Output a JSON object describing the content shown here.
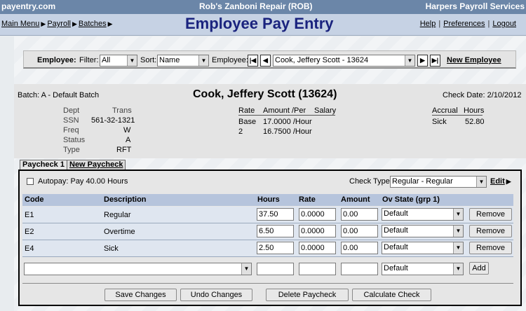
{
  "top": {
    "left": "payentry.com",
    "center": "Rob's Zanboni Repair (ROB)",
    "right": "Harpers Payroll Services"
  },
  "nav": {
    "crumbs": [
      "Main Menu",
      "Payroll",
      "Batches"
    ],
    "title": "Employee Pay Entry",
    "links": [
      "Help",
      "Preferences",
      "Logout"
    ]
  },
  "employee_bar": {
    "label": "Employee:",
    "filter_label": "Filter:",
    "filter_value": "All",
    "sort_label": "Sort:",
    "sort_value": "Name",
    "employee_label": "Employee:",
    "employee_value": "Cook, Jeffery Scott - 13624",
    "new_employee": "New Employee"
  },
  "info": {
    "batch": "Batch: A - Default Batch",
    "name": "Cook, Jeffery Scott (13624)",
    "check_date": "Check Date: 2/10/2012",
    "dept_label": "Dept",
    "trans_label": "Trans",
    "ssn_label": "SSN",
    "ssn_value": "561-32-1321",
    "freq_label": "Freq",
    "freq_value": "W",
    "status_label": "Status",
    "status_value": "A",
    "type_label": "Type",
    "type_value": "RFT",
    "rate_header": "Rate",
    "amount_header": "Amount /Per",
    "salary_header": "Salary",
    "rates": [
      {
        "rate": "Base",
        "amount": "17.0000 /Hour"
      },
      {
        "rate": "2",
        "amount": "16.7500 /Hour"
      }
    ],
    "accrual_header": "Accrual",
    "hours_header": "Hours",
    "accrual_name": "Sick",
    "accrual_hours": "52.80"
  },
  "tabs": [
    "Paycheck 1",
    "New Paycheck"
  ],
  "paycheck": {
    "autopay": "Autopay: Pay 40.00 Hours",
    "check_type_label": "Check Type",
    "check_type_value": "Regular - Regular",
    "edit": "Edit",
    "columns": [
      "Code",
      "Description",
      "Hours",
      "Rate",
      "Amount",
      "Ov State (grp 1)"
    ],
    "rows": [
      {
        "code": "E1",
        "desc": "Regular",
        "hours": "37.50",
        "rate": "0.0000",
        "amount": "0.00",
        "state": "Default",
        "action": "Remove"
      },
      {
        "code": "E2",
        "desc": "Overtime",
        "hours": "6.50",
        "rate": "0.0000",
        "amount": "0.00",
        "state": "Default",
        "action": "Remove"
      },
      {
        "code": "E4",
        "desc": "Sick",
        "hours": "2.50",
        "rate": "0.0000",
        "amount": "0.00",
        "state": "Default",
        "action": "Remove"
      }
    ],
    "new_row": {
      "state": "Default",
      "action": "Add"
    },
    "buttons": [
      "Save Changes",
      "Undo Changes",
      "Delete Paycheck",
      "Calculate Check"
    ]
  },
  "colors": {
    "topbar": "#6b86a8",
    "navbar": "#c6d2e4",
    "title": "#1a237e",
    "grid_header": "#b6c4dc",
    "row": "#dfe6f0"
  }
}
